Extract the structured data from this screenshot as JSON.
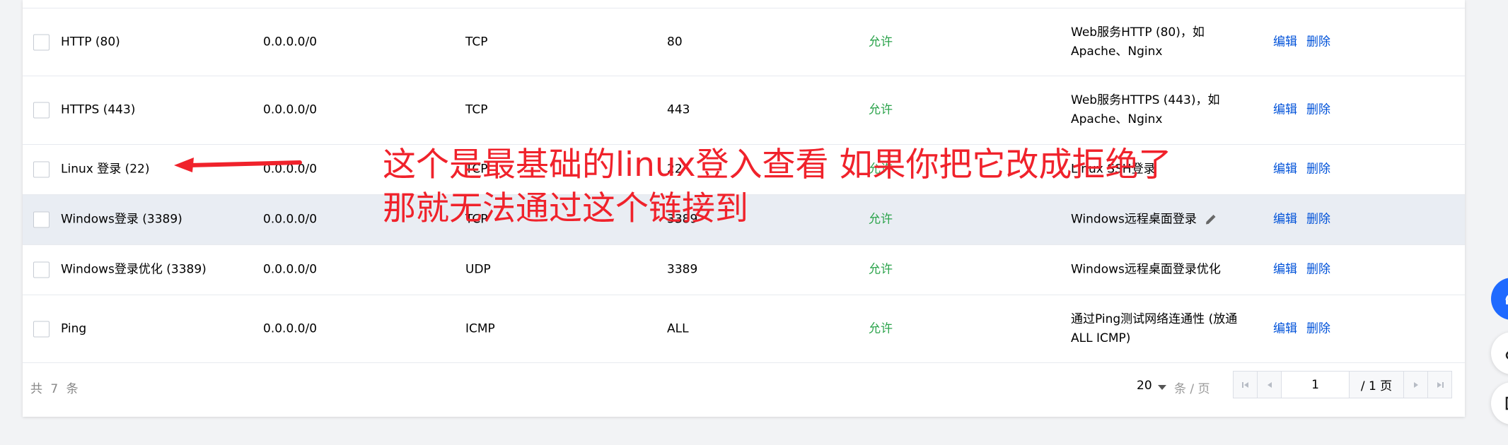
{
  "rows": [
    {
      "name": "HTTP (80)",
      "source": "0.0.0.0/0",
      "protocol": "TCP",
      "port": "80",
      "policy": "允许",
      "note_line1": "Web服务HTTP (80)，如",
      "note_line2": "Apache、Nginx",
      "edit": "编辑",
      "delete": "删除"
    },
    {
      "name": "HTTPS (443)",
      "source": "0.0.0.0/0",
      "protocol": "TCP",
      "port": "443",
      "policy": "允许",
      "note_line1": "Web服务HTTPS (443)，如",
      "note_line2": "Apache、Nginx",
      "edit": "编辑",
      "delete": "删除"
    },
    {
      "name": "Linux 登录 (22)",
      "source": "0.0.0.0/0",
      "protocol": "TCP",
      "port": "22",
      "policy": "允许",
      "note_line1": "Linux SSH登录",
      "note_line2": "",
      "edit": "编辑",
      "delete": "删除"
    },
    {
      "name": "Windows登录 (3389)",
      "source": "0.0.0.0/0",
      "protocol": "TCP",
      "port": "3389",
      "policy": "允许",
      "note_line1": "Windows远程桌面登录",
      "note_line2": "",
      "edit": "编辑",
      "delete": "删除"
    },
    {
      "name": "Windows登录优化 (3389)",
      "source": "0.0.0.0/0",
      "protocol": "UDP",
      "port": "3389",
      "policy": "允许",
      "note_line1": "Windows远程桌面登录优化",
      "note_line2": "",
      "edit": "编辑",
      "delete": "删除"
    },
    {
      "name": "Ping",
      "source": "0.0.0.0/0",
      "protocol": "ICMP",
      "port": "ALL",
      "policy": "允许",
      "note_line1": "通过Ping测试网络连通性 (放通",
      "note_line2": "ALL ICMP)",
      "edit": "编辑",
      "delete": "删除"
    }
  ],
  "footer": {
    "total": "共 7 条",
    "page_size": "20",
    "page_size_unit": "条 / 页",
    "current_page": "1",
    "total_pages": "/ 1 页"
  },
  "annotation": {
    "line1": "这个是最基础的linux登入查看 如果你把它改成拒绝了",
    "line2": "那就无法通过这个链接到"
  },
  "colors": {
    "accent": "#0052d9",
    "allow": "#2ba34b",
    "annotation": "#f0222b",
    "highlight_row": "#e9edf3"
  }
}
